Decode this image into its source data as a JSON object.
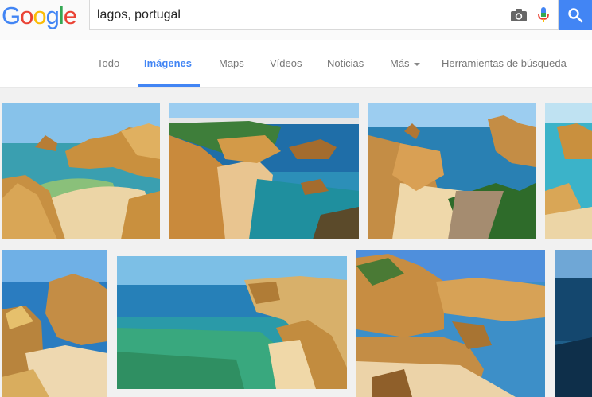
{
  "logo": {
    "letters": [
      "G",
      "o",
      "o",
      "g",
      "l",
      "e"
    ]
  },
  "search": {
    "query": "lagos, portugal"
  },
  "tabs": [
    {
      "label": "Todo"
    },
    {
      "label": "Imágenes"
    },
    {
      "label": "Maps"
    },
    {
      "label": "Vídeos"
    },
    {
      "label": "Noticias"
    },
    {
      "label": "Más"
    },
    {
      "label": "Herramientas de búsqueda"
    }
  ],
  "colors": {
    "accent": "#4285f4",
    "logo": [
      "#4285f4",
      "#ea4335",
      "#fbbc05",
      "#4285f4",
      "#34a853",
      "#ea4335"
    ]
  },
  "icons": [
    "camera-icon",
    "microphone-icon",
    "search-icon"
  ]
}
